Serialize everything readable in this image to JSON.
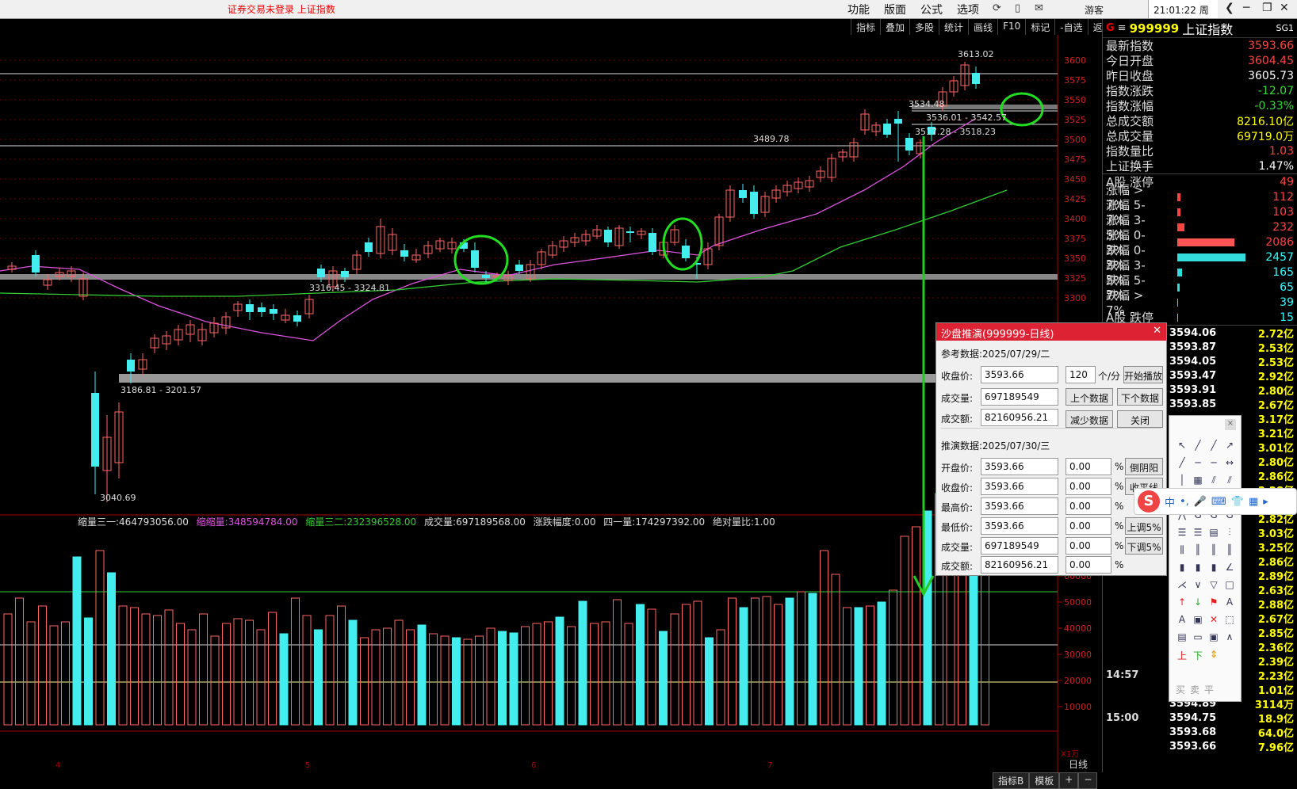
{
  "topbar": {
    "login_status": "证券交易未登录  上证指数",
    "menus": [
      "功能",
      "版面",
      "公式",
      "选项"
    ],
    "guest": "游客",
    "clock": "21:01:22 周日"
  },
  "toolbar": [
    "指标",
    "叠加",
    "多股",
    "统计",
    "画线",
    "F10",
    "标记",
    "-自选",
    "返回"
  ],
  "chart": {
    "price_labels": [
      "3613.02",
      "3534.48",
      "3536.01 - 3542.57",
      "3517.28 - 3518.23",
      "3489.78",
      "3316.45 - 3324.81",
      "3186.81 - 3201.57",
      "3040.69"
    ],
    "y_ticks": [
      "3600",
      "3575",
      "3550",
      "3525",
      "3500",
      "3475",
      "3450",
      "3425",
      "3400",
      "3375",
      "3350",
      "3325",
      "3300"
    ],
    "vol_legend": {
      "a_label": "缩量三一:",
      "a_val": "464793056.00",
      "b_label": "缩缩量:",
      "b_val": "348594784.00",
      "c_label": "缩量三二:",
      "c_val": "232396528.00",
      "d_label": "成交量:",
      "d_val": "697189568.00",
      "e_label": "涨跌幅度:",
      "e_val": "0.00",
      "f_label": "四一量:",
      "f_val": "174297392.00",
      "g_label": "绝对量比:",
      "g_val": "1.00"
    },
    "vol_ticks": [
      "60000",
      "50000",
      "40000",
      "30000",
      "20000",
      "10000"
    ],
    "vol_unit": "X1万",
    "month_marks": [
      "4",
      "5",
      "6",
      "7"
    ],
    "period": "日线"
  },
  "bottom_tabs": [
    "指标B",
    "模板",
    "+",
    "−"
  ],
  "quote": {
    "flag": "G",
    "code": "999999",
    "name": "上证指数",
    "sg": "SG1",
    "rows": [
      {
        "label": "最新指数",
        "value": "3593.66",
        "color": "#ff4444"
      },
      {
        "label": "今日开盘",
        "value": "3604.45",
        "color": "#ff4444"
      },
      {
        "label": "昨日收盘",
        "value": "3605.73",
        "color": "#ffffff"
      },
      {
        "label": "指数涨跌",
        "value": "-12.07",
        "color": "#33dd33"
      },
      {
        "label": "指数涨幅",
        "value": "-0.33%",
        "color": "#33dd33"
      },
      {
        "label": "总成交额",
        "value": "8216.10亿",
        "color": "#ffff00"
      },
      {
        "label": "总成交量",
        "value": "69719.0万",
        "color": "#ffff00"
      },
      {
        "label": "指数量比",
        "value": "1.03",
        "color": "#ff4444"
      },
      {
        "label": "上证换手",
        "value": "1.47%",
        "color": "#ffffff"
      }
    ],
    "breadth": [
      {
        "label": "A股 涨停",
        "value": "49",
        "color": "#ff4444",
        "bar": 0,
        "barcolor": "#f44"
      },
      {
        "label": "涨幅 > 7%",
        "value": "112",
        "color": "#ff4444",
        "bar": 4,
        "barcolor": "#f44"
      },
      {
        "label": "涨幅 5-7%",
        "value": "103",
        "color": "#ff4444",
        "bar": 4,
        "barcolor": "#f44"
      },
      {
        "label": "涨幅 3-5%",
        "value": "232",
        "color": "#ff4444",
        "bar": 9,
        "barcolor": "#f44"
      },
      {
        "label": "涨幅 0-3%",
        "value": "2086",
        "color": "#ff4444",
        "bar": 72,
        "barcolor": "#f55"
      },
      {
        "label": "跌幅 0-3%",
        "value": "2457",
        "color": "#33ffff",
        "bar": 86,
        "barcolor": "#3dd"
      },
      {
        "label": "跌幅 3-5%",
        "value": "165",
        "color": "#33ffff",
        "bar": 6,
        "barcolor": "#3dd"
      },
      {
        "label": "跌幅 5-7%",
        "value": "65",
        "color": "#33ffff",
        "bar": 3,
        "barcolor": "#3dd"
      },
      {
        "label": "跌幅 > 7%",
        "value": "39",
        "color": "#33ffff",
        "bar": 1,
        "barcolor": "#3dd"
      },
      {
        "label": "A股 跌停",
        "value": "15",
        "color": "#33ffff",
        "bar": 1,
        "barcolor": "#3dd"
      }
    ],
    "ticks": [
      {
        "t": "",
        "p": "3594.06",
        "v": "2.72亿"
      },
      {
        "t": "",
        "p": "3593.87",
        "v": "2.53亿"
      },
      {
        "t": "",
        "p": "3594.05",
        "v": "2.53亿"
      },
      {
        "t": "",
        "p": "3593.47",
        "v": "2.92亿"
      },
      {
        "t": "",
        "p": "3593.91",
        "v": "2.80亿"
      },
      {
        "t": "",
        "p": "3593.85",
        "v": "2.67亿"
      },
      {
        "t": "",
        "p": "",
        "v": "3.17亿"
      },
      {
        "t": "",
        "p": "",
        "v": "3.21亿"
      },
      {
        "t": "",
        "p": "",
        "v": "3.01亿"
      },
      {
        "t": "",
        "p": "",
        "v": "2.80亿"
      },
      {
        "t": "",
        "p": "",
        "v": "2.86亿"
      },
      {
        "t": "",
        "p": "",
        "v": "3.28亿"
      },
      {
        "t": "",
        "p": "",
        "v": "3.22亿"
      },
      {
        "t": "",
        "p": "",
        "v": "2.82亿"
      },
      {
        "t": "",
        "p": "",
        "v": "3.03亿"
      },
      {
        "t": "",
        "p": "",
        "v": "3.25亿"
      },
      {
        "t": "",
        "p": "",
        "v": "2.86亿"
      },
      {
        "t": "",
        "p": "",
        "v": "2.89亿"
      },
      {
        "t": "",
        "p": "",
        "v": "2.63亿"
      },
      {
        "t": "",
        "p": "",
        "v": "2.88亿"
      },
      {
        "t": "",
        "p": "",
        "v": "2.67亿"
      },
      {
        "t": "",
        "p": "",
        "v": "2.85亿"
      },
      {
        "t": "",
        "p": "",
        "v": "2.36亿"
      },
      {
        "t": "",
        "p": "",
        "v": "2.39亿"
      },
      {
        "t": "14:57",
        "p": "",
        "v": "2.23亿"
      },
      {
        "t": "",
        "p": "3595.05",
        "v": "1.01亿"
      },
      {
        "t": "",
        "p": "3594.89",
        "v": "3114万"
      },
      {
        "t": "15:00",
        "p": "3594.75",
        "v": "18.9亿"
      },
      {
        "t": "",
        "p": "3593.68",
        "v": "64.0亿"
      },
      {
        "t": "",
        "p": "3593.66",
        "v": "7.96亿"
      }
    ]
  },
  "dialog": {
    "title": "沙盘推演(999999-日线)",
    "ref_label": "参考数据:2025/07/29/二",
    "close_price_label": "收盘价:",
    "close_price": "3593.66",
    "speed": "120",
    "speed_unit": "个/分",
    "volume_label": "成交量:",
    "volume": "697189549",
    "amount_label": "成交额:",
    "amount": "82160956.21",
    "btn_play": "开始播放",
    "btn_prev": "上个数据",
    "btn_next": "下个数据",
    "btn_less": "减少数据",
    "btn_close": "关闭",
    "proj_label": "推演数据:2025/07/30/三",
    "open_label": "开盘价:",
    "open": "3593.66",
    "close2_label": "收盘价:",
    "close2": "3593.66",
    "high_label": "最高价:",
    "high": "3593.66",
    "low_label": "最低价:",
    "low": "3593.66",
    "vol2_label": "成交量:",
    "vol2": "697189549",
    "amt2_label": "成交额:",
    "amt2": "82160956.21",
    "pct": "0.00",
    "pct_sign": "%",
    "btn_yinyang": "倒阴阳",
    "btn_flat": "收平线",
    "btn_up5": "上调5%",
    "btn_down5": "下调5%"
  },
  "ime": [
    "中",
    "•,",
    "🎤",
    "⌨"
  ],
  "palette_footer": "买卖平"
}
